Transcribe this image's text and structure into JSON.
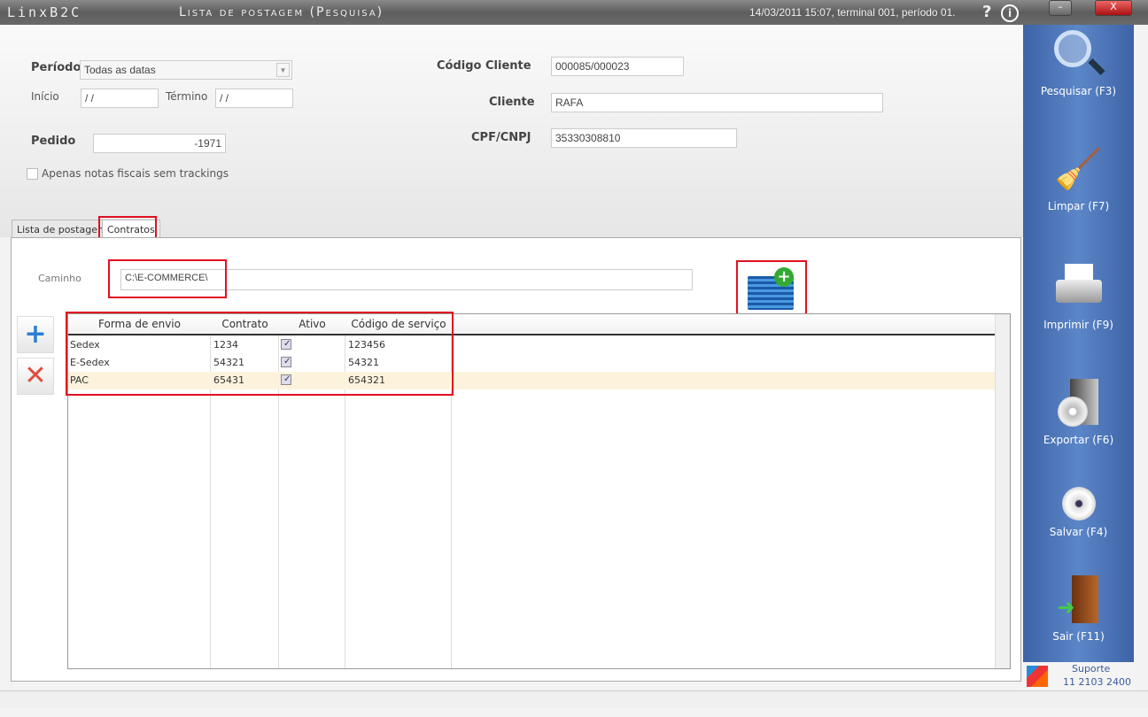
{
  "titlebar": {
    "app": "LinxB2C",
    "title": "Lista de postagem (Pesquisa)",
    "info": "14/03/2011 15:07, terminal 001, período 01.",
    "help": "?",
    "about": "i",
    "minimize": "–",
    "close": "X"
  },
  "filters": {
    "periodo_label": "Período",
    "periodo_value": "Todas as datas",
    "inicio_label": "Início",
    "inicio_value": " /  /",
    "termino_label": "Término",
    "termino_value": " /  /",
    "pedido_label": "Pedido",
    "pedido_value": "-1971",
    "only_nf_label": "Apenas notas fiscais sem trackings",
    "codigo_cliente_label": "Código Cliente",
    "codigo_cliente_value": "000085/000023",
    "cliente_label": "Cliente",
    "cliente_value": "RAFA",
    "cpf_label": "CPF/CNPJ",
    "cpf_value": "35330308810"
  },
  "tabs": [
    {
      "label": "Lista de postagem"
    },
    {
      "label": "Contratos"
    }
  ],
  "contratos": {
    "caminho_label": "Caminho",
    "caminho_value": "C:\\E-COMMERCE\\",
    "columns": [
      "Forma de envio",
      "Contrato",
      "Ativo",
      "Código de serviço"
    ],
    "rows": [
      {
        "forma": "Sedex",
        "contrato": "1234",
        "ativo": true,
        "codigo": "123456"
      },
      {
        "forma": "E-Sedex",
        "contrato": "54321",
        "ativo": true,
        "codigo": "54321"
      },
      {
        "forma": "PAC",
        "contrato": "65431",
        "ativo": true,
        "codigo": "654321"
      }
    ]
  },
  "sidebar": {
    "buttons": [
      {
        "label": "Pesquisar (F3)"
      },
      {
        "label": "Limpar (F7)"
      },
      {
        "label": "Imprimir (F9)"
      },
      {
        "label": "Exportar (F6)"
      },
      {
        "label": "Salvar (F4)"
      },
      {
        "label": "Sair (F11)"
      }
    ],
    "support_label": "Suporte",
    "support_phone": "11 2103 2400"
  }
}
